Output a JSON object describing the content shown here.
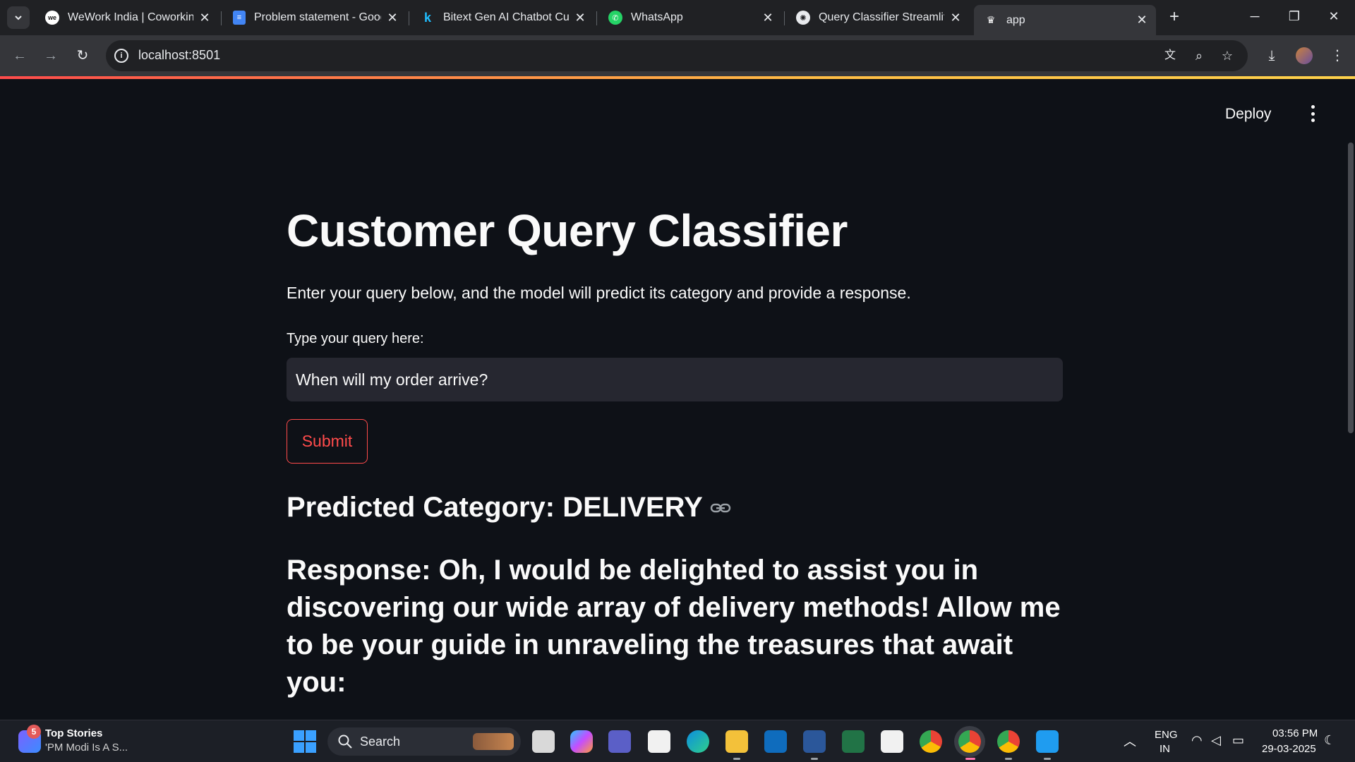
{
  "browser": {
    "tabs": [
      {
        "title": "WeWork India | Coworking",
        "favicon": "wework-icon"
      },
      {
        "title": "Problem statement - Goog",
        "favicon": "google-docs-icon"
      },
      {
        "title": "Bitext Gen AI Chatbot Cust",
        "favicon": "kaggle-icon"
      },
      {
        "title": "WhatsApp",
        "favicon": "whatsapp-icon"
      },
      {
        "title": "Query Classifier Streamlit A",
        "favicon": "chatgpt-icon"
      },
      {
        "title": "app",
        "favicon": "streamlit-icon",
        "active": true
      }
    ],
    "url": "localhost:8501"
  },
  "streamlit": {
    "deploy_label": "Deploy"
  },
  "app": {
    "title": "Customer Query Classifier",
    "intro": "Enter your query below, and the model will predict its category and provide a response.",
    "query_label": "Type your query here:",
    "query_value": "When will my order arrive?",
    "submit_label": "Submit",
    "predicted": "Predicted Category: DELIVERY",
    "response": "Response: Oh, I would be delighted to assist you in discovering our wide array of delivery methods! Allow me to be your guide in unraveling the treasures that await you:"
  },
  "taskbar": {
    "news_badge": "5",
    "news_title": "Top Stories",
    "news_sub": "'PM Modi Is A S...",
    "search_label": "Search",
    "lang_1": "ENG",
    "lang_2": "IN",
    "time": "03:56 PM",
    "date": "29-03-2025"
  },
  "colors": {
    "accent": "#ff4b4b",
    "app_bg": "#0e1117",
    "input_bg": "#262730"
  }
}
